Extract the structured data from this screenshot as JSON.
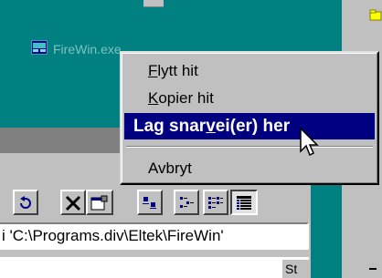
{
  "desktop": {
    "dragged_item_label": "FireWin.exe"
  },
  "context_menu": {
    "items": [
      {
        "pre": "",
        "ul": "F",
        "post": "lytt hit",
        "selected": false
      },
      {
        "pre": "",
        "ul": "K",
        "post": "opier hit",
        "selected": false
      },
      {
        "pre": "Lag snar",
        "ul": "v",
        "post": "ei(er) her",
        "selected": true
      },
      {
        "pre": "Avbryt",
        "ul": "",
        "post": "",
        "selected": false
      }
    ]
  },
  "toolbar": {
    "icons": [
      "undo-icon",
      "delete-icon",
      "properties-icon",
      "large-icons-view-icon",
      "small-icons-view-icon",
      "list-view-icon",
      "details-view-icon"
    ]
  },
  "address_bar": {
    "text": "i 'C:\\Programs.div\\Eltek\\FireWin'"
  },
  "file_list": {
    "column_header_partial": "St"
  },
  "colors": {
    "desktop": "#008080",
    "window_face": "#c0c0c0",
    "highlight": "#000080"
  }
}
